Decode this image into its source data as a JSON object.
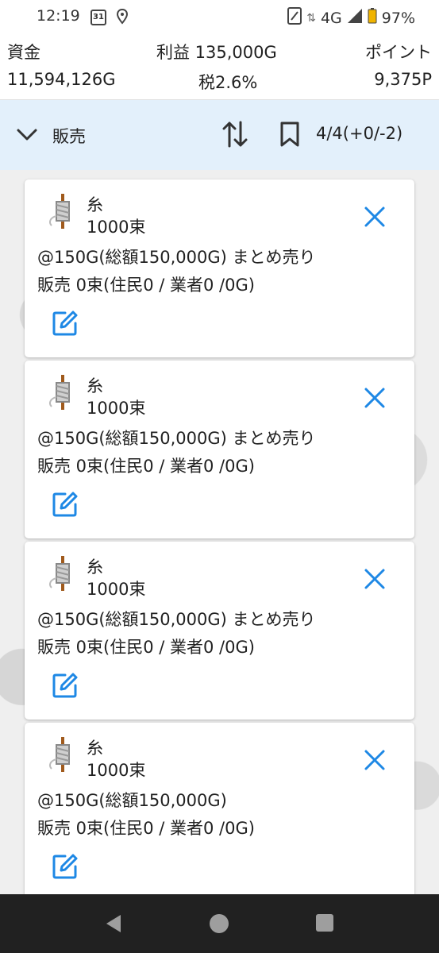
{
  "status_bar": {
    "time": "12:19",
    "calendar_day": "31",
    "network": "4G",
    "battery": "97%"
  },
  "stats": {
    "funds_label": "資金",
    "funds_value": "11,594,126G",
    "profit_label": "利益 135,000G",
    "tax_label": "税2.6%",
    "points_label": "ポイント",
    "points_value": "9,375P"
  },
  "toolbar": {
    "mode_label": "販売",
    "count": "4/4(+0/-2)"
  },
  "cards": [
    {
      "name": "糸",
      "quantity": "1000束",
      "price": "@150G(総額150,000G) まとめ売り",
      "sold": "販売 0束(住民0 / 業者0 /0G)"
    },
    {
      "name": "糸",
      "quantity": "1000束",
      "price": "@150G(総額150,000G) まとめ売り",
      "sold": "販売 0束(住民0 / 業者0 /0G)"
    },
    {
      "name": "糸",
      "quantity": "1000束",
      "price": "@150G(総額150,000G) まとめ売り",
      "sold": "販売 0束(住民0 / 業者0 /0G)"
    },
    {
      "name": "糸",
      "quantity": "1000束",
      "price": "@150G(総額150,000G)",
      "sold": "販売 0束(住民0 / 業者0 /0G)"
    }
  ],
  "colors": {
    "accent": "#1e88e5",
    "toolbar_bg": "#e3f0fb",
    "navbar_bg": "#212121"
  }
}
